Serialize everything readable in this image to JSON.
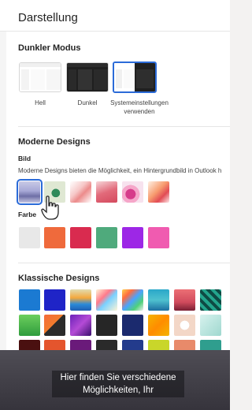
{
  "header": {
    "title": "Darstellung"
  },
  "dark_mode": {
    "heading": "Dunkler Modus",
    "options": [
      {
        "label": "Hell"
      },
      {
        "label": "Dunkel"
      },
      {
        "label": "Systemeinstellungen verwenden",
        "selected": true
      }
    ]
  },
  "modern": {
    "heading": "Moderne Designs",
    "image_label": "Bild",
    "image_desc": "Moderne Designs bieten die Möglichkeit, ein Hintergrundbild in Outlook h",
    "color_label": "Farbe",
    "colors": [
      "#e8e8e8",
      "#ef6a3c",
      "#d92b4f",
      "#4faa7c",
      "#9d27e6",
      "#f05bb0"
    ]
  },
  "classic": {
    "heading": "Klassische Designs"
  },
  "caption": {
    "text": "Hier finden Sie verschiedene Möglichkeiten, Ihr"
  },
  "colors": {
    "accent": "#2b6bd8"
  }
}
